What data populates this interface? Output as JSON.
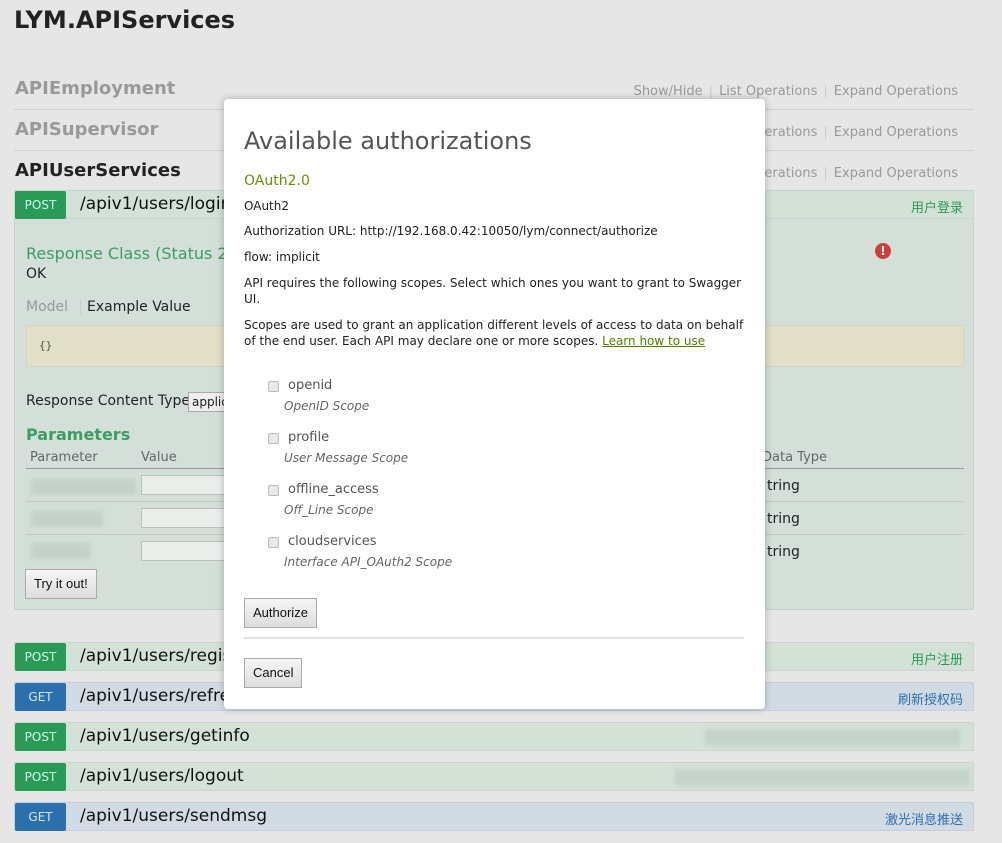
{
  "app_title": "LYM.APIServices",
  "resources": [
    {
      "name": "APIEmployment",
      "links": [
        "Show/Hide",
        "List Operations",
        "Expand Operations"
      ]
    },
    {
      "name": "APISupervisor",
      "links": [
        "Operations",
        "Expand Operations"
      ]
    },
    {
      "name": "APIUserServices",
      "links": [
        "Operations",
        "Expand Operations"
      ]
    }
  ],
  "login_op": {
    "method": "POST",
    "path": "/apiv1/users/login",
    "summary": "用户登录"
  },
  "panel": {
    "response_class": "Response Class (Status 20",
    "ok": "OK",
    "model_tab": "Model",
    "example_tab": "Example Value",
    "example": "{}",
    "content_type_label": "Response Content Type",
    "content_type_value": "applic",
    "params_title": "Parameters",
    "col_param": "Parameter",
    "col_value": "Value",
    "col_type": "Data Type",
    "types": [
      "tring",
      "tring",
      "tring"
    ],
    "try_button": "Try it out!"
  },
  "ops": [
    {
      "method": "POST",
      "path": "/apiv1/users/regist",
      "summary": "用户注册"
    },
    {
      "method": "GET",
      "path": "/apiv1/users/refres",
      "summary": "刷新授权码"
    },
    {
      "method": "POST",
      "path": "/apiv1/users/getinfo",
      "summary": ""
    },
    {
      "method": "POST",
      "path": "/apiv1/users/logout",
      "summary": ""
    },
    {
      "method": "GET",
      "path": "/apiv1/users/sendmsg",
      "summary": "激光消息推送"
    }
  ],
  "modal": {
    "title": "Available authorizations",
    "auth_name": "OAuth2.0",
    "auth_type": "OAuth2",
    "auth_url": "Authorization URL: http://192.168.0.42:10050/lym/connect/authorize",
    "flow": "flow: implicit",
    "scopes_intro": "API requires the following scopes. Select which ones you want to grant to Swagger UI.",
    "scopes_desc": "Scopes are used to grant an application different levels of access to data on behalf of the end user. Each API may declare one or more scopes.",
    "learn_link": "Learn how to use",
    "scopes": [
      {
        "name": "openid",
        "desc": "OpenID Scope",
        "checked": false
      },
      {
        "name": "profile",
        "desc": "User Message Scope",
        "checked": false
      },
      {
        "name": "offline_access",
        "desc": "Off_Line Scope",
        "checked": false
      },
      {
        "name": "cloudservices",
        "desc": "Interface API_OAuth2 Scope",
        "checked": false
      }
    ],
    "authorize_button": "Authorize",
    "cancel_button": "Cancel"
  }
}
